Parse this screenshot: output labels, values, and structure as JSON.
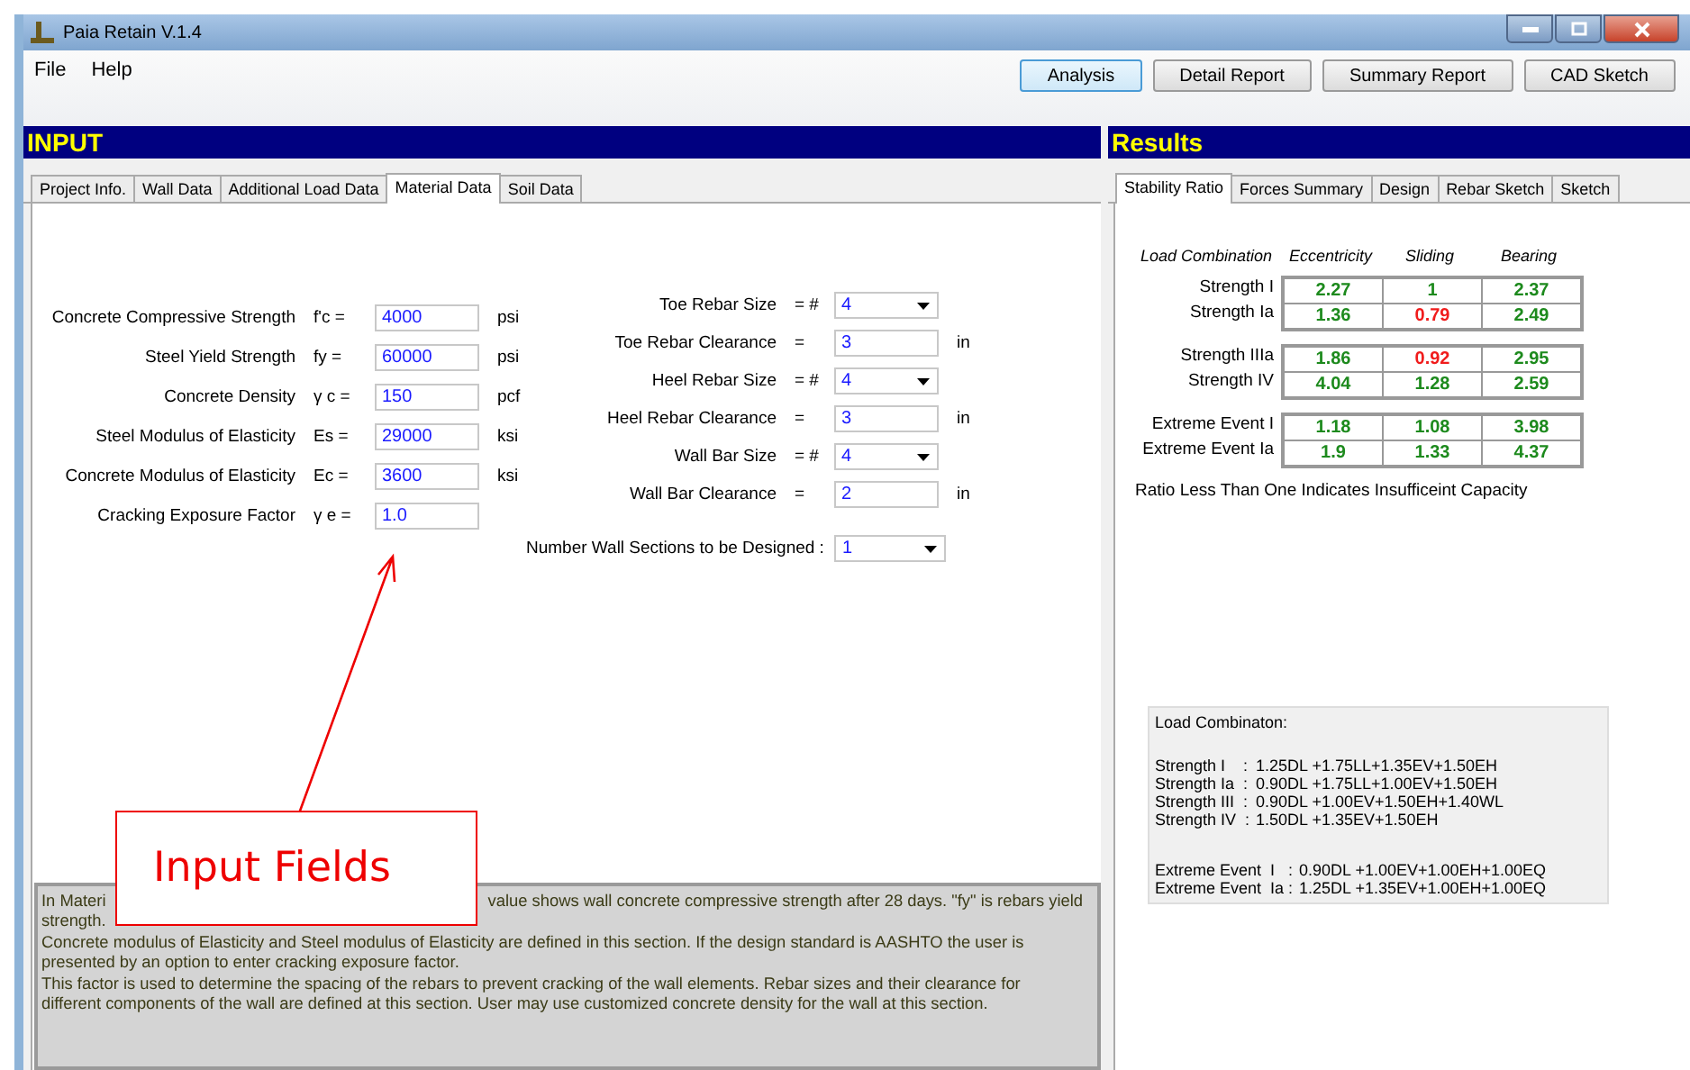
{
  "window": {
    "title": "Paia Retain V.1.4"
  },
  "menu": [
    "File",
    "Help"
  ],
  "toolbar": [
    {
      "label": "Analysis",
      "selected": true
    },
    {
      "label": "Detail Report",
      "selected": false
    },
    {
      "label": "Summary Report",
      "selected": false
    },
    {
      "label": "CAD Sketch",
      "selected": false
    }
  ],
  "input": {
    "title": "INPUT",
    "tabs": [
      {
        "label": "Project Info.",
        "selected": false
      },
      {
        "label": "Wall Data",
        "selected": false
      },
      {
        "label": "Additional Load Data",
        "selected": false
      },
      {
        "label": "Material Data",
        "selected": true
      },
      {
        "label": "Soil Data",
        "selected": false
      }
    ],
    "material_fields": [
      {
        "label": "Concrete Compressive Strength",
        "symbol": "f'c =",
        "value": "4000",
        "unit": "psi"
      },
      {
        "label": "Steel Yield Strength",
        "symbol": "fy =",
        "value": "60000",
        "unit": "psi"
      },
      {
        "label": "Concrete Density",
        "symbol": "γ c =",
        "value": "150",
        "unit": "pcf"
      },
      {
        "label": "Steel Modulus of Elasticity",
        "symbol": "Es =",
        "value": "29000",
        "unit": "ksi"
      },
      {
        "label": "Concrete Modulus of Elasticity",
        "symbol": "Ec =",
        "value": "3600",
        "unit": "ksi"
      },
      {
        "label": "Cracking Exposure Factor",
        "symbol": "γ e =",
        "value": "1.0"
      }
    ],
    "rebar_fields": [
      {
        "kind": "select",
        "label": "Toe Rebar Size",
        "symbol": "= #",
        "value": "4"
      },
      {
        "kind": "input",
        "label": "Toe Rebar Clearance",
        "symbol": "=",
        "value": "3",
        "unit": "in"
      },
      {
        "kind": "select",
        "label": "Heel Rebar Size",
        "symbol": "= #",
        "value": "4"
      },
      {
        "kind": "input",
        "label": "Heel Rebar Clearance",
        "symbol": "=",
        "value": "3",
        "unit": "in"
      },
      {
        "kind": "select",
        "label": "Wall Bar Size",
        "symbol": "= #",
        "value": "4"
      },
      {
        "kind": "input",
        "label": "Wall Bar Clearance",
        "symbol": "=",
        "value": "2",
        "unit": "in"
      }
    ],
    "sections": {
      "label": "Number Wall Sections to be Designed :",
      "value": "1"
    },
    "description": {
      "first_line": [
        "In Materi",
        "value shows wall concrete compressive strength after 28 days. \"fy\" is rebars yield"
      ],
      "lines": [
        "strength.",
        "Concrete modulus of Elasticity and Steel modulus of Elasticity are defined in this section.  If the design standard is AASHTO the user is",
        "presented by an option to enter cracking exposure factor.",
        "This factor is used to determine the spacing of the rebars to prevent cracking of the wall elements. Rebar sizes and their clearance for",
        "different components of the wall are defined at this section. User may use customized concrete density for the wall at this section."
      ]
    }
  },
  "results": {
    "title": "Results",
    "tabs": [
      {
        "label": "Stability Ratio",
        "selected": true
      },
      {
        "label": "Forces Summary",
        "selected": false
      },
      {
        "label": "Design",
        "selected": false
      },
      {
        "label": "Rebar Sketch",
        "selected": false
      },
      {
        "label": "Sketch",
        "selected": false
      }
    ],
    "columns": [
      "Load Combination",
      "Eccentricity",
      "Sliding",
      "Bearing"
    ],
    "groups": [
      {
        "rows": [
          {
            "name": "Strength I",
            "values": [
              {
                "text": "2.27",
                "insufficient": false
              },
              {
                "text": "1",
                "insufficient": false
              },
              {
                "text": "2.37",
                "insufficient": false
              }
            ]
          },
          {
            "name": "Strength Ia",
            "values": [
              {
                "text": "1.36",
                "insufficient": false
              },
              {
                "text": "0.79",
                "insufficient": true
              },
              {
                "text": "2.49",
                "insufficient": false
              }
            ]
          }
        ]
      },
      {
        "rows": [
          {
            "name": "Strength IIIa",
            "values": [
              {
                "text": "1.86",
                "insufficient": false
              },
              {
                "text": "0.92",
                "insufficient": true
              },
              {
                "text": "2.95",
                "insufficient": false
              }
            ]
          },
          {
            "name": "Strength IV",
            "values": [
              {
                "text": "4.04",
                "insufficient": false
              },
              {
                "text": "1.28",
                "insufficient": false
              },
              {
                "text": "2.59",
                "insufficient": false
              }
            ]
          }
        ]
      },
      {
        "rows": [
          {
            "name": "Extreme Event I",
            "values": [
              {
                "text": "1.18",
                "insufficient": false
              },
              {
                "text": "1.08",
                "insufficient": false
              },
              {
                "text": "3.98",
                "insufficient": false
              }
            ]
          },
          {
            "name": "Extreme Event Ia",
            "values": [
              {
                "text": "1.9",
                "insufficient": false
              },
              {
                "text": "1.33",
                "insufficient": false
              },
              {
                "text": "4.37",
                "insufficient": false
              }
            ]
          }
        ]
      }
    ],
    "note": "Ratio Less Than One Indicates Insufficeint Capacity",
    "load_combinations": {
      "title": "Load Combinaton:",
      "strength": [
        {
          "name": "Strength I    :",
          "formula": "1.25DL +1.75LL+1.35EV+1.50EH"
        },
        {
          "name": "Strength Ia  :",
          "formula": "0.90DL +1.75LL+1.00EV+1.50EH"
        },
        {
          "name": "Strength III  :",
          "formula": "0.90DL +1.00EV+1.50EH+1.40WL"
        },
        {
          "name": "Strength IV  :",
          "formula": "1.50DL +1.35EV+1.50EH"
        }
      ],
      "extreme": [
        {
          "name": "Extreme Event  I   :",
          "formula": "0.90DL +1.00EV+1.00EH+1.00EQ"
        },
        {
          "name": "Extreme Event  Ia :",
          "formula": "1.25DL +1.35EV+1.00EH+1.00EQ"
        }
      ]
    }
  },
  "callout": {
    "text": "Input Fields"
  }
}
